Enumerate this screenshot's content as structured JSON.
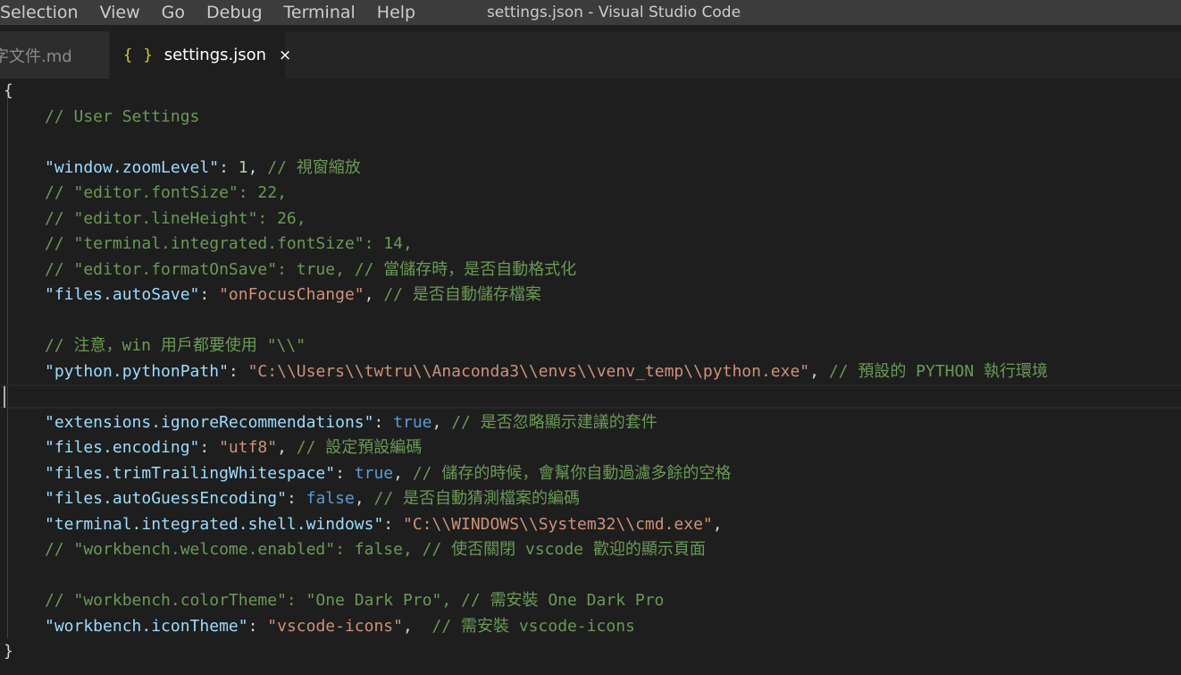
{
  "window": {
    "title": "settings.json - Visual Studio Code"
  },
  "menu": {
    "items": [
      "Selection",
      "View",
      "Go",
      "Debug",
      "Terminal",
      "Help"
    ]
  },
  "tabs": [
    {
      "label": "字文件.md",
      "active": false
    },
    {
      "label": "settings.json",
      "active": true,
      "icon": "{ }",
      "close": "×"
    }
  ],
  "editor": {
    "lines": [
      {
        "indent": "",
        "parts": [
          [
            "p",
            "{"
          ]
        ]
      },
      {
        "indent": "    ",
        "parts": [
          [
            "c",
            "// User Settings"
          ]
        ]
      },
      {
        "indent": "",
        "parts": []
      },
      {
        "indent": "    ",
        "parts": [
          [
            "k",
            "\"window.zoomLevel\""
          ],
          [
            "p",
            ": "
          ],
          [
            "n",
            "1"
          ],
          [
            "p",
            ", "
          ],
          [
            "c",
            "// 視窗縮放"
          ]
        ]
      },
      {
        "indent": "    ",
        "parts": [
          [
            "c",
            "// \"editor.fontSize\": 22,"
          ]
        ]
      },
      {
        "indent": "    ",
        "parts": [
          [
            "c",
            "// \"editor.lineHeight\": 26,"
          ]
        ]
      },
      {
        "indent": "    ",
        "parts": [
          [
            "c",
            "// \"terminal.integrated.fontSize\": 14,"
          ]
        ]
      },
      {
        "indent": "    ",
        "parts": [
          [
            "c",
            "// \"editor.formatOnSave\": true, // 當儲存時，是否自動格式化"
          ]
        ]
      },
      {
        "indent": "    ",
        "parts": [
          [
            "k",
            "\"files.autoSave\""
          ],
          [
            "p",
            ": "
          ],
          [
            "s",
            "\"onFocusChange\""
          ],
          [
            "p",
            ", "
          ],
          [
            "c",
            "// 是否自動儲存檔案"
          ]
        ]
      },
      {
        "indent": "",
        "parts": []
      },
      {
        "indent": "    ",
        "parts": [
          [
            "c",
            "// 注意，win 用戶都要使用 \"\\\\\""
          ]
        ]
      },
      {
        "indent": "    ",
        "parts": [
          [
            "k",
            "\"python.pythonPath\""
          ],
          [
            "p",
            ": "
          ],
          [
            "s",
            "\"C:\\\\Users\\\\twtru\\\\Anaconda3\\\\envs\\\\venv_temp\\\\python.exe\""
          ],
          [
            "p",
            ", "
          ],
          [
            "c",
            "// 預設的 PYTHON 執行環境"
          ]
        ]
      },
      {
        "indent": "",
        "parts": []
      },
      {
        "indent": "    ",
        "parts": [
          [
            "k",
            "\"extensions.ignoreRecommendations\""
          ],
          [
            "p",
            ": "
          ],
          [
            "b",
            "true"
          ],
          [
            "p",
            ", "
          ],
          [
            "c",
            "// 是否忽略顯示建議的套件"
          ]
        ]
      },
      {
        "indent": "    ",
        "parts": [
          [
            "k",
            "\"files.encoding\""
          ],
          [
            "p",
            ": "
          ],
          [
            "s",
            "\"utf8\""
          ],
          [
            "p",
            ", "
          ],
          [
            "c",
            "// 設定預設編碼"
          ]
        ]
      },
      {
        "indent": "    ",
        "parts": [
          [
            "k",
            "\"files.trimTrailingWhitespace\""
          ],
          [
            "p",
            ": "
          ],
          [
            "b",
            "true"
          ],
          [
            "p",
            ", "
          ],
          [
            "c",
            "// 儲存的時候，會幫你自動過濾多餘的空格"
          ]
        ]
      },
      {
        "indent": "    ",
        "parts": [
          [
            "k",
            "\"files.autoGuessEncoding\""
          ],
          [
            "p",
            ": "
          ],
          [
            "b",
            "false"
          ],
          [
            "p",
            ", "
          ],
          [
            "c",
            "// 是否自動猜測檔案的編碼"
          ]
        ]
      },
      {
        "indent": "    ",
        "parts": [
          [
            "k",
            "\"terminal.integrated.shell.windows\""
          ],
          [
            "p",
            ": "
          ],
          [
            "s",
            "\"C:\\\\WINDOWS\\\\System32\\\\cmd.exe\""
          ],
          [
            "p",
            ","
          ]
        ]
      },
      {
        "indent": "    ",
        "parts": [
          [
            "c",
            "// \"workbench.welcome.enabled\": false, // 使否關閉 vscode 歡迎的顯示頁面"
          ]
        ]
      },
      {
        "indent": "",
        "parts": []
      },
      {
        "indent": "    ",
        "parts": [
          [
            "c",
            "// \"workbench.colorTheme\": \"One Dark Pro\", // 需安裝 One Dark Pro"
          ]
        ]
      },
      {
        "indent": "    ",
        "parts": [
          [
            "k",
            "\"workbench.iconTheme\""
          ],
          [
            "p",
            ": "
          ],
          [
            "s",
            "\"vscode-icons\""
          ],
          [
            "p",
            ",  "
          ],
          [
            "c",
            "// 需安裝 vscode-icons"
          ]
        ]
      },
      {
        "indent": "",
        "parts": [
          [
            "p",
            "}"
          ]
        ]
      }
    ]
  }
}
